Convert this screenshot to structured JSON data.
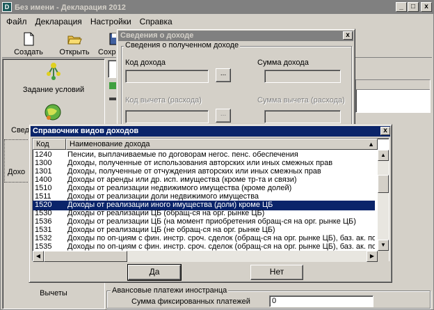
{
  "window": {
    "title": "Без имени - Декларация 2012",
    "minimize": "_",
    "maximize": "□",
    "close": "x"
  },
  "menu": [
    {
      "label": "Файл"
    },
    {
      "label": "Декларация"
    },
    {
      "label": "Настройки"
    },
    {
      "label": "Справка"
    }
  ],
  "toolbar": {
    "create": "Создать",
    "open": "Открыть",
    "save": "Сохр"
  },
  "left_nav": {
    "conditions": "Задание условий",
    "info": "Свед",
    "income": "Дохо",
    "deductions": "Вычеты"
  },
  "bottom_panel": {
    "group_title": "Авансовые платежи иностранца",
    "fixed_payments_label": "Сумма фиксированных платежей",
    "fixed_payments_value": "0"
  },
  "income_dialog": {
    "title": "Сведения о доходе",
    "group_title": "Сведения о полученном доходе",
    "code_label": "Код дохода",
    "amount_label": "Сумма дохода",
    "deduction_code_label": "Код вычета (расхода)",
    "deduction_amount_label": "Сумма вычета (расхода)",
    "browse": "...",
    "close": "x"
  },
  "ref_dialog": {
    "title": "Справочник видов доходов",
    "close": "x",
    "columns": [
      "Код",
      "Наименование дохода"
    ],
    "rows": [
      {
        "code": "1240",
        "name": "Пенсии, выплачиваемые по договорам негос. пенс. обеспечения"
      },
      {
        "code": "1300",
        "name": "Доходы, полученные от использования авторских или иных смежных прав"
      },
      {
        "code": "1301",
        "name": "Доходы, полученные от отчуждения авторских или иных смежных прав"
      },
      {
        "code": "1400",
        "name": "Доходы от аренды или др. исп. имущества (кроме тр-та и связи)"
      },
      {
        "code": "1510",
        "name": "Доходы от реализации недвижимого имущества (кроме долей)"
      },
      {
        "code": "1511",
        "name": "Доходы от реализации доли недвижимого имущества"
      },
      {
        "code": "1520",
        "name": "Доходы от реализации иного имущества (доли) кроме ЦБ"
      },
      {
        "code": "1530",
        "name": "Доходы от реализации ЦБ (обращ-ся на орг. рынке ЦБ)"
      },
      {
        "code": "1536",
        "name": "Доходы от реализации ЦБ (на момент приобретения обращ-ся на орг. рынке ЦБ)"
      },
      {
        "code": "1531",
        "name": "Доходы от реализации ЦБ (не обращ-ся на орг. рынке ЦБ)"
      },
      {
        "code": "1532",
        "name": "Доходы по оп-циям с фин. инстр. сроч. сделок (обращ-ся на орг. рынке ЦБ), баз. ак. по..."
      },
      {
        "code": "1535",
        "name": "Доходы по оп-циям с фин. инстр. сроч. сделок (обращ-ся на орг. рынке ЦБ), баз. ак. по..."
      }
    ],
    "selected_code": "1520",
    "ok": "Да",
    "cancel": "Нет"
  }
}
